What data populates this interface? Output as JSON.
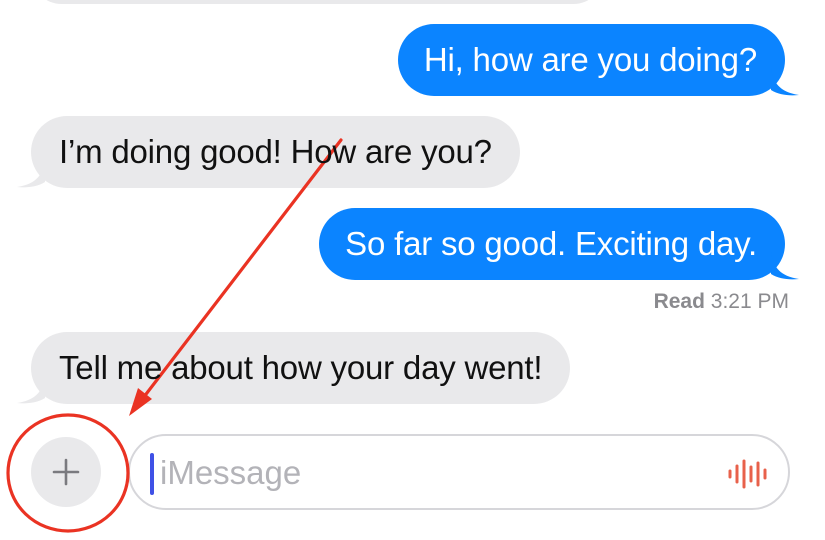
{
  "messages": [
    {
      "direction": "outgoing",
      "text": "Hi, how are you doing?"
    },
    {
      "direction": "incoming",
      "text": "I’m doing good! How are you?"
    },
    {
      "direction": "outgoing",
      "text": "So far so good. Exciting day."
    },
    {
      "direction": "incoming",
      "text": "Tell me about how your day went!"
    }
  ],
  "receipt": {
    "status": "Read",
    "time": "3:21 PM"
  },
  "composer": {
    "placeholder": "iMessage",
    "add_icon": "plus-icon",
    "voice_icon": "audio-waveform-icon"
  },
  "colors": {
    "outgoing_bubble": "#0b84ff",
    "incoming_bubble": "#e9e9eb",
    "annotation": "#ea3323",
    "voice_icon": "#e8614b"
  }
}
